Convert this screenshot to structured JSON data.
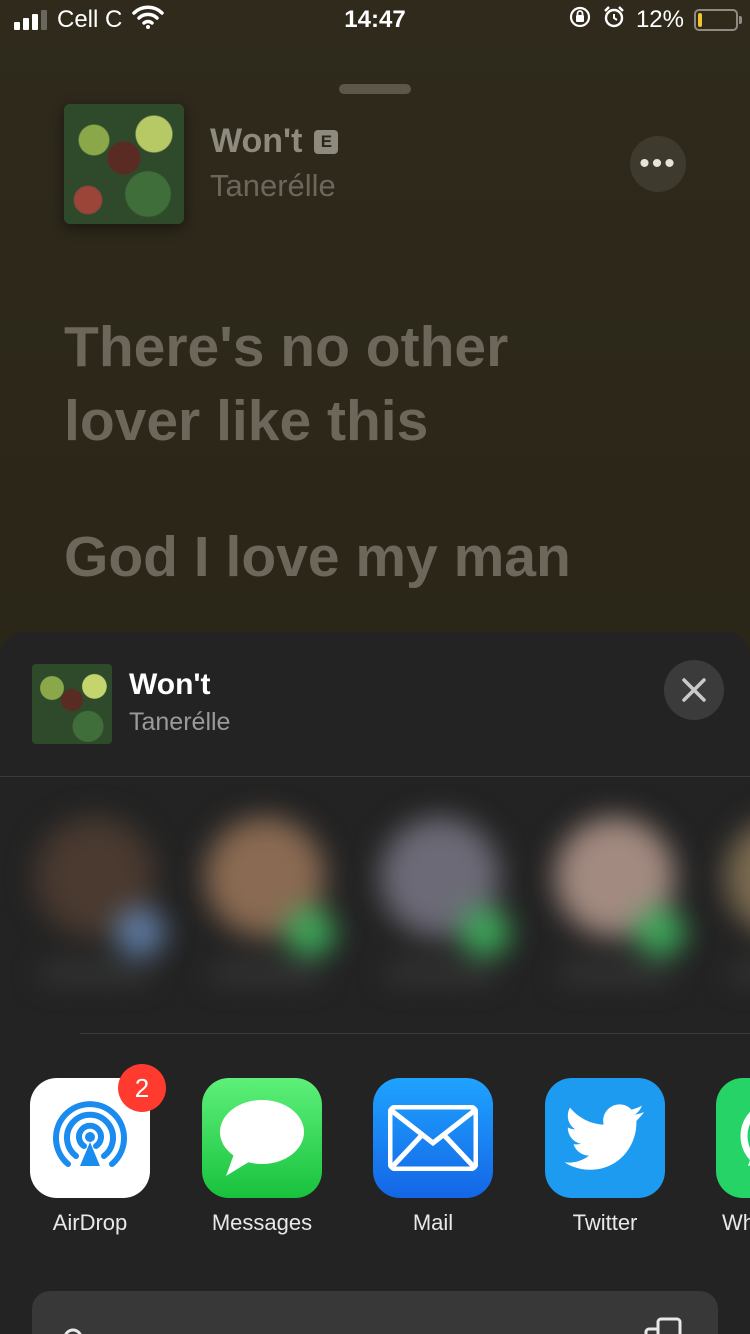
{
  "status": {
    "carrier": "Cell C",
    "time": "14:47",
    "battery": "12%",
    "battery_level": 0.12
  },
  "now_playing": {
    "title": "Won't",
    "explicit": "E",
    "artist": "Tanerélle",
    "more_glyph": "•••"
  },
  "lyrics": [
    "There's no other\nlover like this",
    "God I love my man"
  ],
  "share_sheet": {
    "title": "Won't",
    "artist": "Tanerélle",
    "apps": [
      {
        "label": "AirDrop",
        "icon": "airdrop-icon",
        "badge": "2",
        "color": "#ffffff"
      },
      {
        "label": "Messages",
        "icon": "messages-icon",
        "color": "#34c759"
      },
      {
        "label": "Mail",
        "icon": "mail-icon",
        "color": "#1f8ef5"
      },
      {
        "label": "Twitter",
        "icon": "twitter-icon",
        "color": "#1d9bf0"
      },
      {
        "label": "Wh",
        "icon": "whatsapp-icon",
        "color": "#25d366"
      }
    ]
  }
}
